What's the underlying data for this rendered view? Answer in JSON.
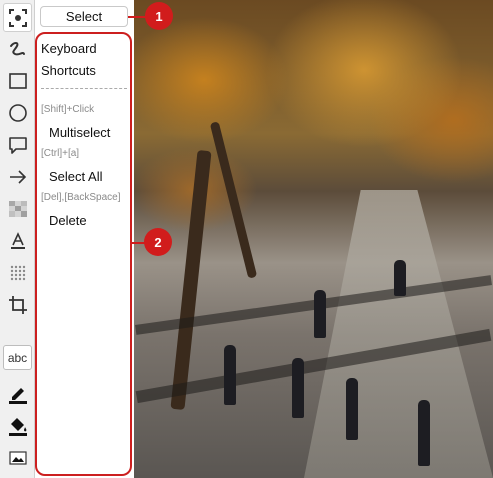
{
  "toolbar": {
    "tools": [
      {
        "name": "select-tool",
        "icon": "select-icon"
      },
      {
        "name": "freehand-tool",
        "icon": "freehand-icon"
      },
      {
        "name": "rectangle-tool",
        "icon": "rectangle-icon"
      },
      {
        "name": "ellipse-tool",
        "icon": "ellipse-icon"
      },
      {
        "name": "callout-tool",
        "icon": "speech-bubble-icon"
      },
      {
        "name": "arrow-tool",
        "icon": "arrow-icon"
      },
      {
        "name": "pixelate-tool",
        "icon": "pixelate-icon"
      },
      {
        "name": "text-underline-tool",
        "icon": "text-underline-icon"
      },
      {
        "name": "dots-tool",
        "icon": "dots-grid-icon"
      },
      {
        "name": "crop-tool",
        "icon": "crop-icon"
      }
    ],
    "text_tool_label": "abc",
    "bottom_tools": [
      {
        "name": "stroke-color",
        "icon": "pen-icon"
      },
      {
        "name": "fill-color",
        "icon": "paint-bucket-icon"
      },
      {
        "name": "image-tool",
        "icon": "image-icon"
      }
    ]
  },
  "select_button": {
    "label": "Select"
  },
  "panel": {
    "title_line1": "Keyboard",
    "title_line2": "Shortcuts",
    "shortcuts": [
      {
        "keys": "[Shift]+Click",
        "action": "Multiselect"
      },
      {
        "keys": "[Ctrl]+[a]",
        "action": "Select All"
      },
      {
        "keys": "[Del],[BackSpace]",
        "action": "Delete"
      }
    ]
  },
  "markers": [
    {
      "label": "1"
    },
    {
      "label": "2"
    }
  ],
  "colors": {
    "accent": "#d11c1c",
    "panel_border": "#cc1f1f"
  }
}
